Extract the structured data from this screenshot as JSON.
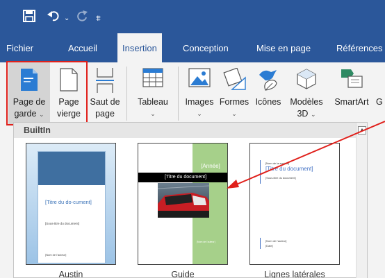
{
  "quick_access": {
    "save_icon": "save-icon",
    "undo_icon": "undo-icon",
    "redo_icon": "redo-icon",
    "customize_icon": "customize-qat-icon"
  },
  "menu": {
    "tabs": [
      "Fichier",
      "Accueil",
      "Insertion",
      "Conception",
      "Mise en page",
      "Références"
    ],
    "active": "Insertion"
  },
  "ribbon": {
    "page_de_garde": {
      "line1": "Page de",
      "line2": "garde",
      "caret": "⌄"
    },
    "page_vierge": {
      "line1": "Page",
      "line2": "vierge"
    },
    "saut_de_page": {
      "line1": "Saut de",
      "line2": "page"
    },
    "tableau": {
      "line1": "Tableau",
      "caret": "⌄"
    },
    "images": {
      "line1": "Images",
      "caret": "⌄"
    },
    "formes": {
      "line1": "Formes",
      "caret": "⌄"
    },
    "icones": {
      "line1": "Icônes"
    },
    "modeles3d": {
      "line1": "Modèles",
      "line2": "3D",
      "caret": "⌄"
    },
    "smartart": {
      "line1": "SmartArt"
    },
    "cut_label": "G"
  },
  "gallery": {
    "section_title": "BuiltIn",
    "scroll_up": "▲",
    "items": [
      {
        "caption": "Austin",
        "title": "[Titre du do-cument]",
        "subtitle": "[Sous-titre du document]",
        "footer": "[Nom de l'auteur]"
      },
      {
        "caption": "Guide",
        "year": "[Année]",
        "title": "[Titre du document]",
        "footer": "[Nom de l'auteur]"
      },
      {
        "caption": "Lignes latérales",
        "company": "[Nom de la société]",
        "title": "[Titre du document]",
        "subtitle": "[Sous-titre du document]",
        "author": "[Nom de l'auteur]",
        "date": "[Date]"
      }
    ]
  },
  "colors": {
    "accent": "#2b579a",
    "highlight": "#e0201b",
    "austin_title": "#3b73b8",
    "lignes_title": "#4472c4",
    "guide_green": "#a6d08a"
  }
}
